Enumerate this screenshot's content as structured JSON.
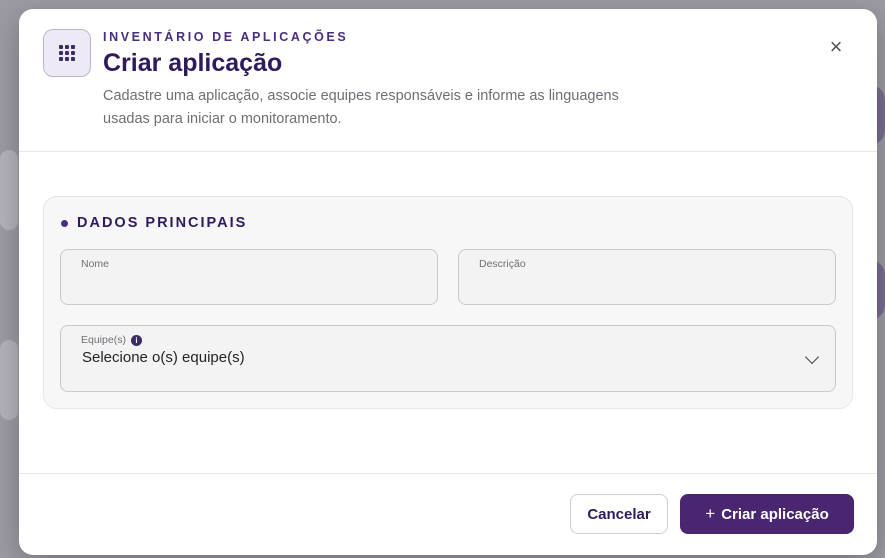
{
  "modal": {
    "eyebrow": "INVENTÁRIO DE APLICAÇÕES",
    "title": "Criar aplicação",
    "subtitle_line1": "Cadastre uma aplicação, associe equipes responsáveis e informe as linguagens",
    "subtitle_line2": "usadas para iniciar o monitoramento.",
    "close_label": "×"
  },
  "section": {
    "title": "DADOS PRINCIPAIS",
    "fields": {
      "name_label": "Nome",
      "name_value": "",
      "description_label": "Descrição",
      "description_value": "",
      "teams_label": "Equipe(s)",
      "teams_info_glyph": "i",
      "teams_value": "Selecione o(s) equipe(s)"
    }
  },
  "footer": {
    "cancel_label": "Cancelar",
    "create_icon": "+",
    "create_label": "Criar aplicação"
  },
  "colors": {
    "accent": "#4a2570",
    "title": "#2f1a5c",
    "eyebrow": "#4a2d80"
  }
}
